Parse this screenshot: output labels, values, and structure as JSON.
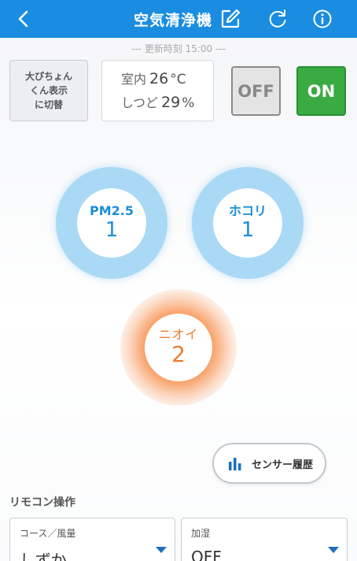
{
  "header": {
    "title": "空気清浄機",
    "bg_color": "#1a8de0"
  },
  "status": {
    "updated_text": "--- 更新時刻 15:00 ---"
  },
  "display_toggle": {
    "label_line1": "大ぴちょん",
    "label_line2": "くん表示",
    "label_line3": "に切替"
  },
  "environment": {
    "temp_label": "室内",
    "temp_value": "26",
    "temp_unit": "°C",
    "humidity_label": "しつど",
    "humidity_value": "29",
    "humidity_unit": "%"
  },
  "power": {
    "off_label": "OFF",
    "on_label": "ON",
    "state": "ON"
  },
  "sensors": {
    "pm25": {
      "name": "PM2.5",
      "level": "1"
    },
    "dust": {
      "name": "ホコリ",
      "level": "1"
    },
    "odor": {
      "name": "ニオイ",
      "level": "2"
    }
  },
  "sensor_history": {
    "label": "センサー履歴"
  },
  "remote": {
    "section_label": "リモコン操作",
    "course": {
      "label": "コース／風量",
      "value": "しずか"
    },
    "humidify": {
      "label": "加湿",
      "value": "OFF"
    }
  }
}
